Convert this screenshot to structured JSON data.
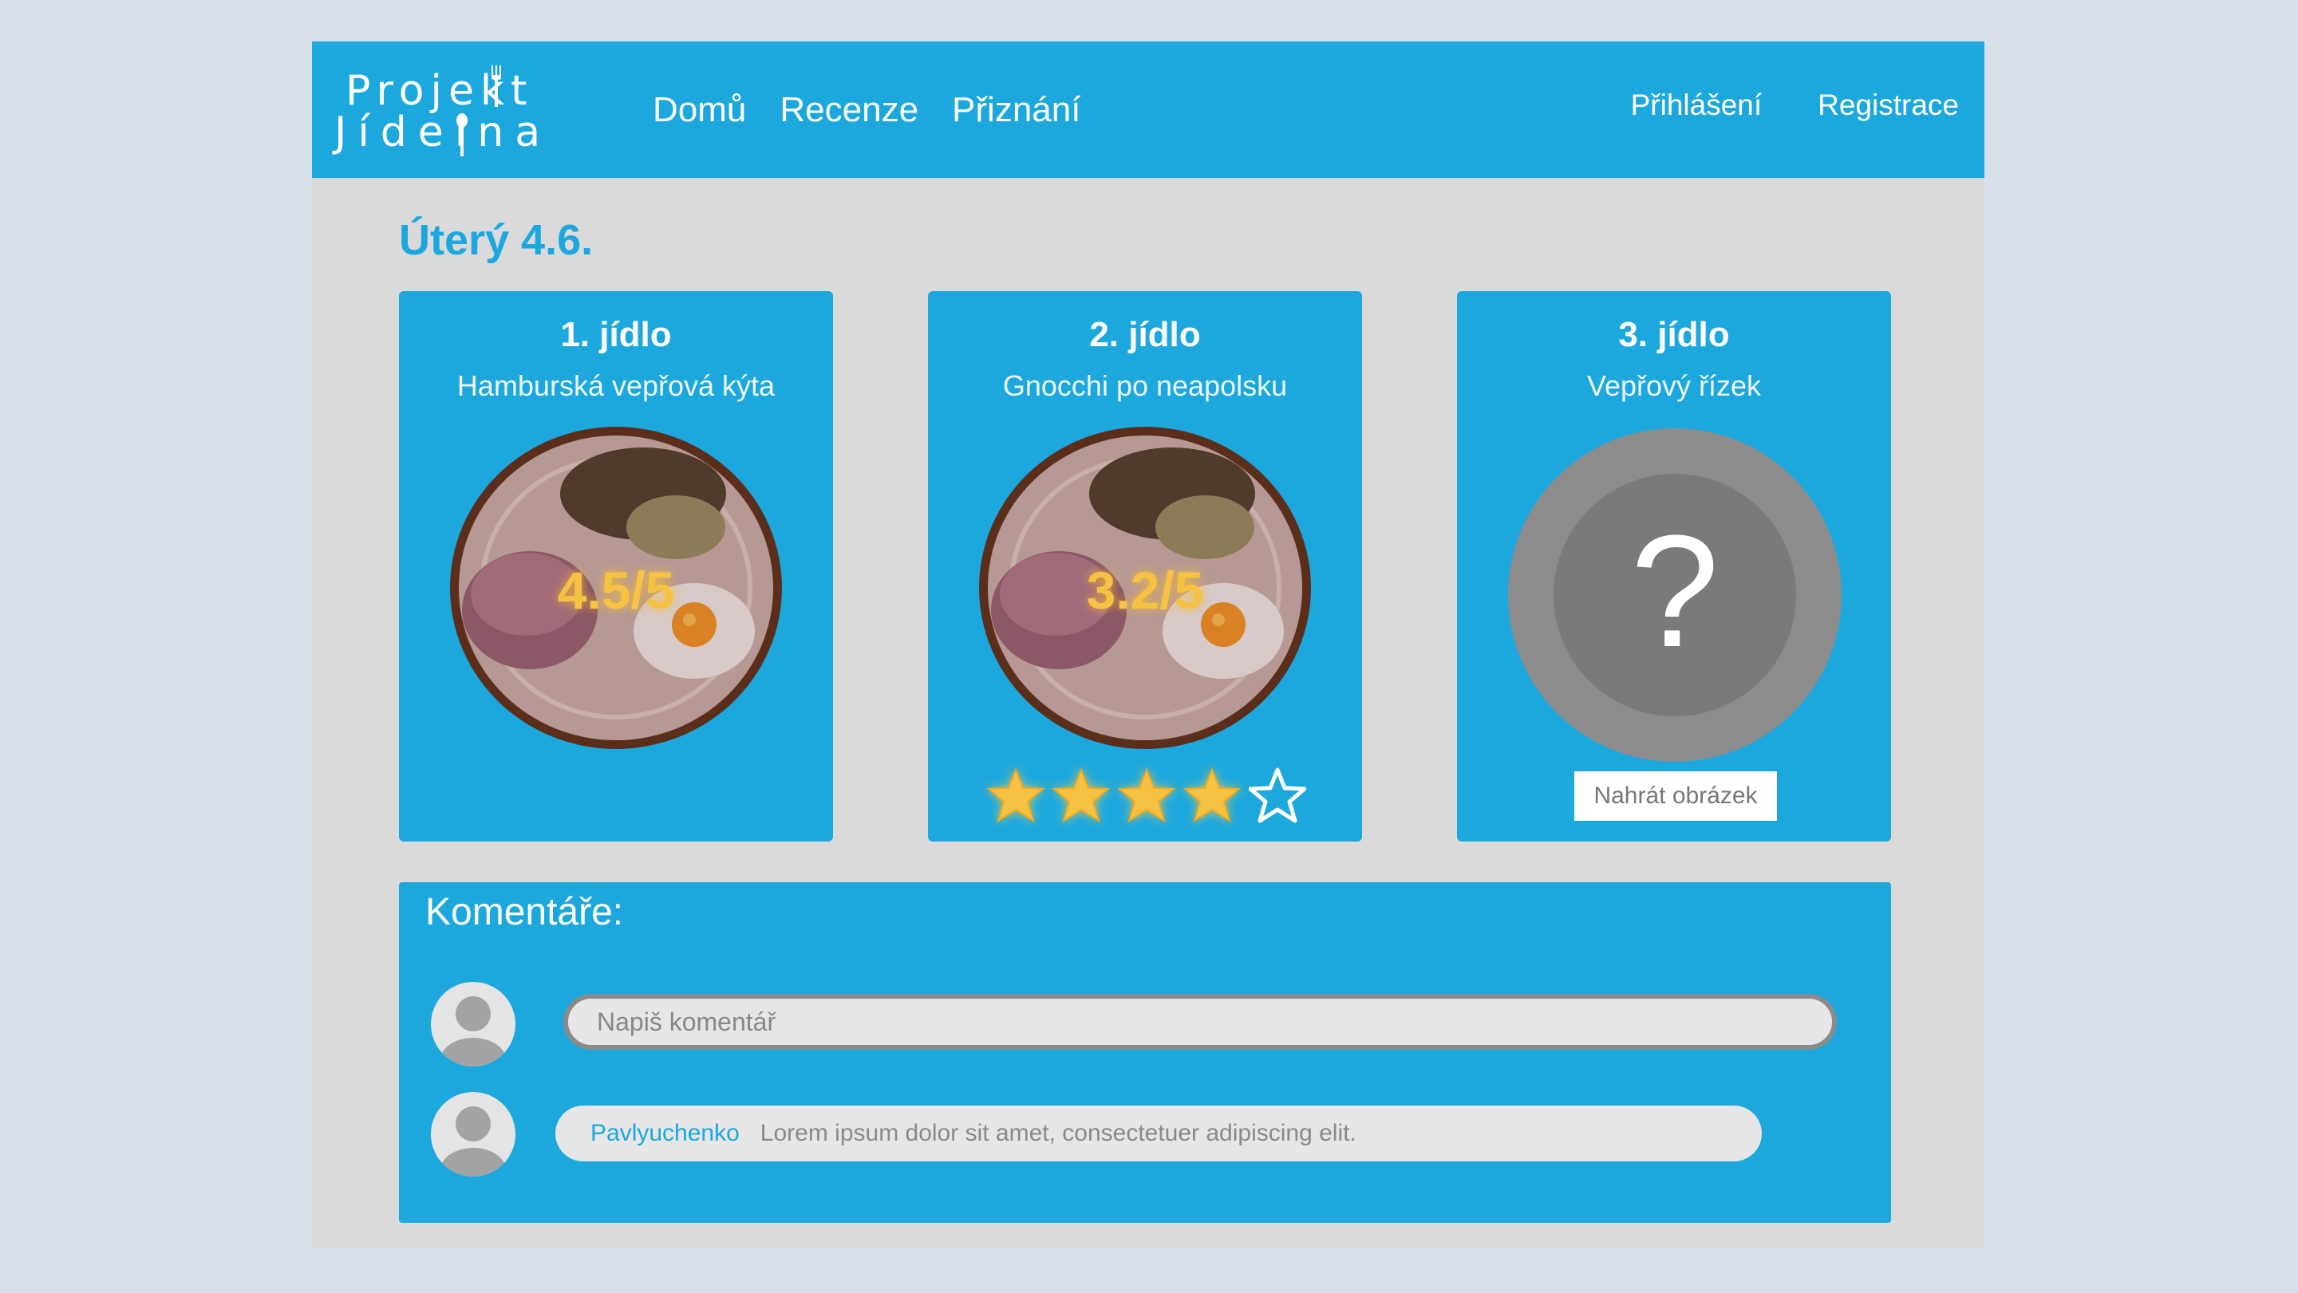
{
  "brand": {
    "line1": "Projekt",
    "line2": "Jídelna",
    "color": "#1ca8dd"
  },
  "nav": {
    "left": [
      "Domů",
      "Recenze",
      "Přiznání"
    ],
    "login": "Přihlášení",
    "register": "Registrace"
  },
  "day_title": "Úterý 4.6.",
  "meals": [
    {
      "title": "1. jídlo",
      "name": "Hamburská vepřová kýta",
      "rating": "4.5/5"
    },
    {
      "title": "2. jídlo",
      "name": "Gnocchi po neapolsku",
      "rating": "3.2/5",
      "user_stars": 4,
      "max_stars": 5
    },
    {
      "title": "3. jídlo",
      "name": "Vepřový řízek",
      "placeholder_symbol": "?",
      "upload_label": "Nahrát obrázek"
    }
  ],
  "comments": {
    "title": "Komentáře:",
    "input_placeholder": "Napiš komentář",
    "items": [
      {
        "author": "Pavlyuchenko",
        "text": "Lorem ipsum dolor sit amet, consectetuer adipiscing elit."
      }
    ]
  },
  "colors": {
    "accent": "#1ca8dd",
    "page_background": "#d7dfe8",
    "content_background": "#dadada",
    "rating_gold": "#f6c244"
  },
  "icons": {
    "plate_photo": "food-plate-image",
    "star_filled": "star-filled-icon",
    "star_empty": "star-outline-icon",
    "avatar": "user-avatar-icon"
  }
}
